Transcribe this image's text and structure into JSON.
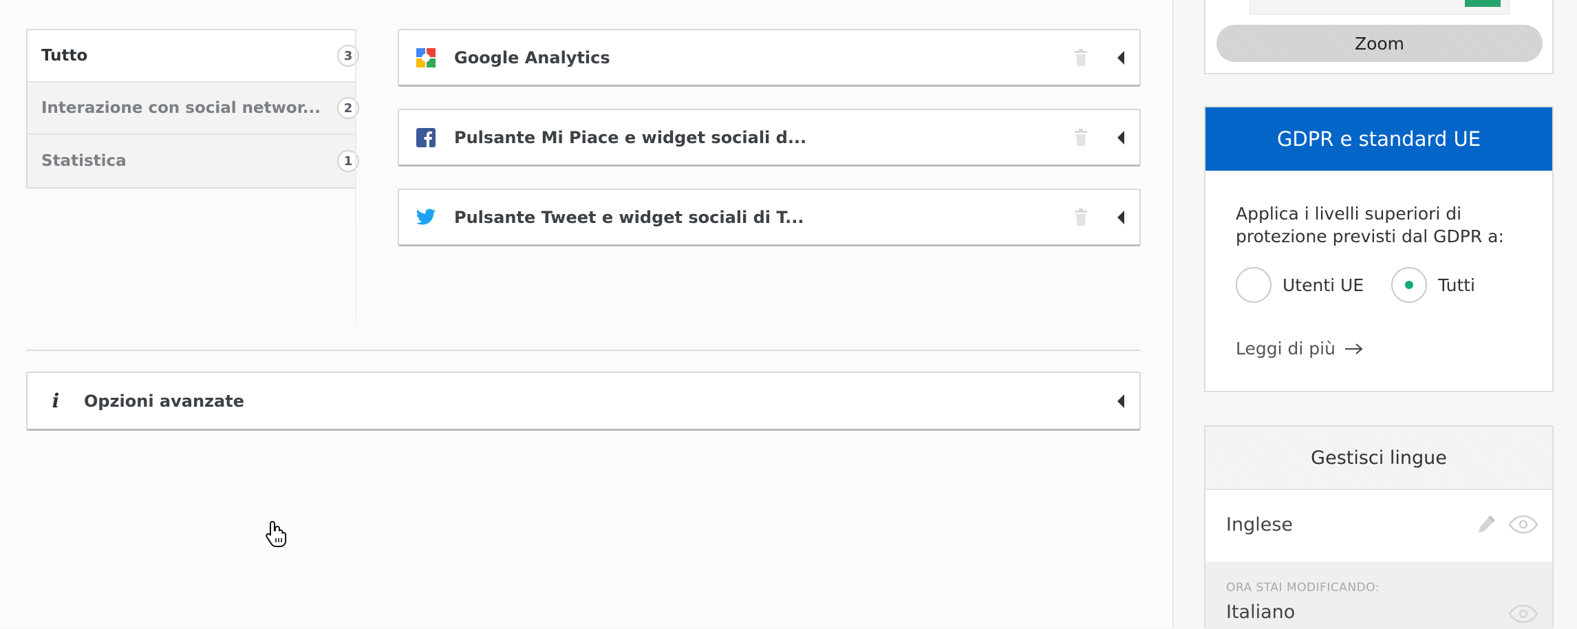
{
  "categories": [
    {
      "name": "Tutto",
      "count": "3"
    },
    {
      "name": "Interazione con social networ...",
      "count": "2"
    },
    {
      "name": "Statistica",
      "count": "1"
    }
  ],
  "services": [
    {
      "label": "Google Analytics",
      "icon": "google-analytics-icon"
    },
    {
      "label": "Pulsante Mi Piace e widget sociali d...",
      "icon": "facebook-icon"
    },
    {
      "label": "Pulsante Tweet e widget sociali di T...",
      "icon": "twitter-icon"
    }
  ],
  "advanced": {
    "label": "Opzioni avanzate",
    "icon": "info-icon"
  },
  "zoom": {
    "label": "Zoom"
  },
  "gdpr": {
    "title": "GDPR e standard UE",
    "text": "Applica i livelli superiori di protezione previsti dal GDPR a:",
    "options": [
      "Utenti UE",
      "Tutti"
    ],
    "selected": "Tutti",
    "read_more": "Leggi di più"
  },
  "languages": {
    "title": "Gestisci lingue",
    "items": [
      "Inglese"
    ],
    "editing_caption": "ORA STAI MODIFICANDO:",
    "editing_language": "Italiano"
  },
  "colors": {
    "accent_blue": "#0465c8",
    "radio_selected": "#16a876",
    "facebook": "#3b5998",
    "twitter": "#1da1f2"
  }
}
